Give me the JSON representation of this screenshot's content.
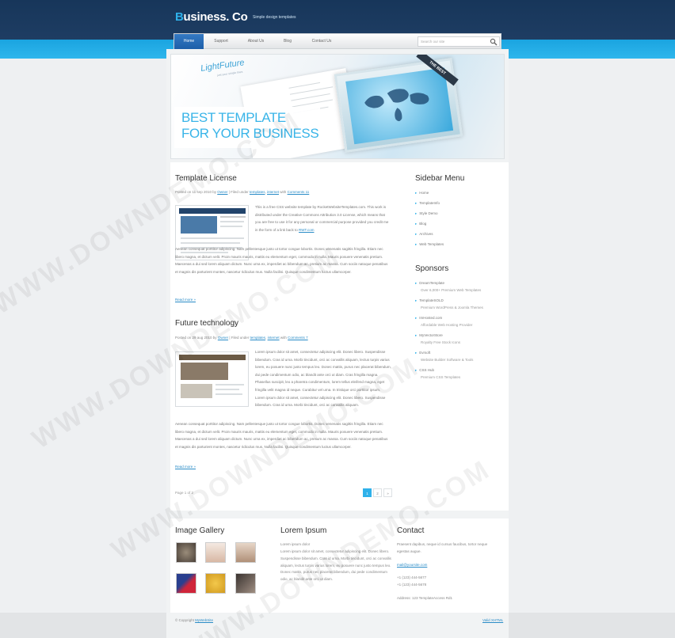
{
  "header": {
    "logo_first_letter": "B",
    "logo_rest": "usiness. Co",
    "tagline": "Simple design templates",
    "nav": [
      {
        "label": "Home"
      },
      {
        "label": "Support"
      },
      {
        "label": "About Us"
      },
      {
        "label": "Blog"
      },
      {
        "label": "Contact Us"
      }
    ],
    "search_placeholder": "Search our site"
  },
  "banner": {
    "brand": "LightFuture",
    "brand_sub": "just your simple lines",
    "headline_1": "BEST TEMPLATE",
    "headline_2": "FOR YOUR BUSINESS",
    "ribbon": "THE BEST"
  },
  "posts": [
    {
      "title": "Template License",
      "meta_prefix": "Posted on 11 sep 2010 by",
      "author": "Owner",
      "meta_mid": "| Filed under",
      "cat1": "templates",
      "cat_sep": ",",
      "cat2": "internet",
      "meta_with": "with",
      "comments": "Comments 11",
      "intro": "This is a free CSS website template by RocketWebsiteTemplates.com. This work is distributed under the Creative Commons Attribution 3.0 License, which means that you are free to use it for any personal or commercial purpose provided you credit me in the form of a link back to",
      "intro_link": "RWT.com",
      "body": "Aenean consequat porttitor adipiscing. Nam pellentesque justo ut tortor congue lobortis. Donec venenatis sagittis fringilla. Etiam nec libero magna, et dictum velit. Proin mauris mauris, mattis eu elementum eget, commodo in nulla. Mauris posuere venenatis pretium. Maecenas a dui sed lorem aliquam dictum. Nunc urna ex, imperdiet ac bibendum ac, pretium ac massa. Cum sociis natoque penatibus et magnis dis parturient montes, nascetur ridiculus mus. Nulla facilisi. Quisque condimentum luctus ullamcorper.",
      "read_more": "Read more »"
    },
    {
      "title": "Future technology",
      "meta_prefix": "Posted on 29 aug 2010 by",
      "author": "Owner",
      "meta_mid": "| Filed under",
      "cat1": "templates",
      "cat_sep": ",",
      "cat2": "internet",
      "meta_with": "with",
      "comments": "Comments 7",
      "intro": "Lorem ipsum dolor sit amet, consectetur adipiscing elit. Donec libero. Suspendisse bibendum. Cras id urna. Morbi tincidunt, orci ac convallis aliquam, lectus turpis varius lorem, eu posuere nunc justo tempus leo. Donec mattis, purus nec placerat bibendum, dui pede condimentum odio, ac blandit ante orci ut diam. Cras fringilla magna. Phasellus suscipit, leo a pharetra condimentum, lorem tellus eleifend magna, eget fringilla velit magna id neque. Curabitur vel urna. In tristique orci porttitor ipsum. Lorem ipsum dolor sit amet, consectetur adipiscing elit. Donec libero. Suspendisse bibendum. Cras id urna. Morbi tincidunt, orci ac convallis aliquam.",
      "body": "Aenean consequat porttitor adipiscing. Nam pellentesque justo ut tortor congue lobortis. Donec venenatis sagittis fringilla. Etiam nec libero magna, et dictum velit. Proin mauris mauris, mattis eu elementum eget, commodo in nulla. Mauris posuere venenatis pretium. Maecenas a dui sed lorem aliquam dictum. Nunc urna ex, imperdiet ac bibendum ac, pretium ac massa. Cum sociis natoque penatibus et magnis dis parturient montes, nascetur ridiculus mus. Nulla facilisi. Quisque condimentum luctus ullamcorper.",
      "read_more": "Read more »"
    }
  ],
  "pagination": {
    "label": "Page 1 of 2",
    "pages": [
      "1",
      "2",
      "»"
    ]
  },
  "sidebar": {
    "menu_title": "Sidebar Menu",
    "menu": [
      "Home",
      "TemplateInfo",
      "Style Demo",
      "Blog",
      "Archives",
      "Web Templates"
    ],
    "sponsors_title": "Sponsors",
    "sponsors": [
      {
        "name": "DreamTemplate",
        "desc": "Over 6,000+ Premium Web Templates"
      },
      {
        "name": "TemplateSOLD",
        "desc": "Premium WordPress & Joomla Themes"
      },
      {
        "name": "ImHosted.com",
        "desc": "Affordable Web Hosting Provider"
      },
      {
        "name": "MyVectorStore",
        "desc": "Royalty Free Stock Icons"
      },
      {
        "name": "Evrsoft",
        "desc": "Website Builder Software & Tools"
      },
      {
        "name": "CSS Hub",
        "desc": "Premium CSS Templates"
      }
    ]
  },
  "footer": {
    "gallery_title": "Image Gallery",
    "lorem_title": "Lorem Ipsum",
    "lorem_heading": "Lorem ipsum dolor",
    "lorem_text": "Lorem ipsum dolor sit amet, consectetur adipiscing elit. Donec libero. Suspendisse bibendum. Cras id urna. Morbi tincidunt, orci ac convallis aliquam, lectus turpis varius lorem, eu posuere nunc justo tempus leo. Donec mattis, purus nec placerat bibendum, dui pede condimentum odio, ac blandit ante orci ut diam.",
    "contact_title": "Contact",
    "contact_text": "Praesent dapibus, neque id cursus faucibus, tortor neque egestas augue.",
    "email": "mail@yoursite.com",
    "phone1": "+1 (123) 444-5677",
    "phone2": "+1 (123) 444-5678",
    "address": "Address: 123 TemplateAccess Rd1",
    "copyright_prefix": "© Copyright",
    "copyright_link": "MyWebSite",
    "valid": "Valid XHTML"
  },
  "watermark": "WWW.DOWNDEMO.COM",
  "colors": {
    "accent": "#2fb1ea",
    "nav_active": "#2a6db8",
    "header": "#1a3a5f"
  }
}
